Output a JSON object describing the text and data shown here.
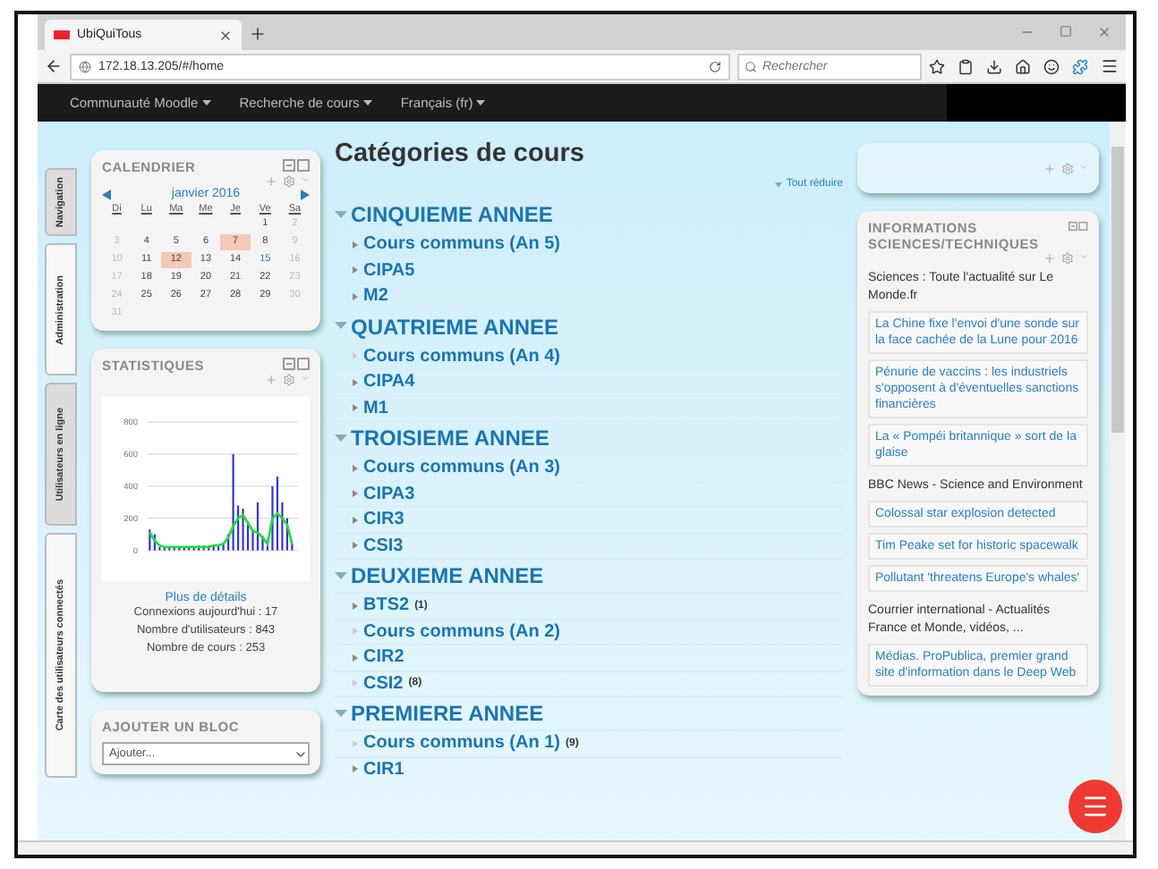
{
  "browser": {
    "tab_title": "UbiQuiTous",
    "url": "172.18.13.205/#/home",
    "search_placeholder": "Rechercher"
  },
  "navbar": {
    "items": [
      "Communauté Moodle",
      "Recherche de cours",
      "Français (fr)"
    ]
  },
  "side_tabs": [
    {
      "label": "Navigation",
      "selected": false
    },
    {
      "label": "Administration",
      "selected": true
    },
    {
      "label": "Utilisateurs en ligne",
      "selected": false
    },
    {
      "label": "Carte des utilisateurs connectés",
      "selected": true
    }
  ],
  "calendar": {
    "title": "CALENDRIER",
    "month": "janvier 2016",
    "weekdays": [
      "Di",
      "Lu",
      "Ma",
      "Me",
      "Je",
      "Ve",
      "Sa"
    ],
    "weeks": [
      [
        {
          "day": "1",
          "highlight": false,
          "today": false
        },
        {
          "day": "2",
          "highlight": false,
          "today": false
        }
      ],
      [
        {
          "day": "3",
          "highlight": false,
          "today": false
        },
        {
          "day": "4",
          "highlight": false,
          "today": false
        },
        {
          "day": "5",
          "highlight": false,
          "today": false
        },
        {
          "day": "6",
          "highlight": false,
          "today": false
        },
        {
          "day": "7",
          "highlight": true,
          "today": false
        },
        {
          "day": "8",
          "highlight": false,
          "today": false
        },
        {
          "day": "9",
          "highlight": false,
          "today": false
        }
      ],
      [
        {
          "day": "10",
          "highlight": false,
          "today": false
        },
        {
          "day": "11",
          "highlight": false,
          "today": false
        },
        {
          "day": "12",
          "highlight": true,
          "today": false
        },
        {
          "day": "13",
          "highlight": false,
          "today": false
        },
        {
          "day": "14",
          "highlight": false,
          "today": false
        },
        {
          "day": "15",
          "highlight": false,
          "today": true
        },
        {
          "day": "16",
          "highlight": false,
          "today": false
        }
      ],
      [
        {
          "day": "17",
          "highlight": false,
          "today": false
        },
        {
          "day": "18",
          "highlight": false,
          "today": false
        },
        {
          "day": "19",
          "highlight": false,
          "today": false
        },
        {
          "day": "20",
          "highlight": false,
          "today": false
        },
        {
          "day": "21",
          "highlight": false,
          "today": false
        },
        {
          "day": "22",
          "highlight": false,
          "today": false
        },
        {
          "day": "23",
          "highlight": false,
          "today": false
        }
      ],
      [
        {
          "day": "24",
          "highlight": false,
          "today": false
        },
        {
          "day": "25",
          "highlight": false,
          "today": false
        },
        {
          "day": "26",
          "highlight": false,
          "today": false
        },
        {
          "day": "27",
          "highlight": false,
          "today": false
        },
        {
          "day": "28",
          "highlight": false,
          "today": false
        },
        {
          "day": "29",
          "highlight": false,
          "today": false
        },
        {
          "day": "30",
          "highlight": false,
          "today": false
        }
      ],
      [
        {
          "day": "31",
          "highlight": false,
          "today": false
        }
      ]
    ]
  },
  "statistics": {
    "title": "STATISTIQUES",
    "chart_data": {
      "type": "bar",
      "ylim": [
        0,
        800
      ],
      "yticks": [
        0,
        200,
        400,
        600,
        800
      ],
      "grid": true,
      "series": [
        {
          "type": "bar",
          "color": "#3434d0",
          "values": [
            130,
            100,
            20,
            20,
            20,
            20,
            20,
            20,
            20,
            20,
            30,
            30,
            30,
            30,
            30,
            40,
            100,
            600,
            280,
            260,
            180,
            130,
            300,
            90,
            30,
            400,
            460,
            300,
            200,
            40
          ]
        },
        {
          "type": "line",
          "color": "#22dd33",
          "values": [
            110,
            60,
            30,
            20,
            20,
            20,
            20,
            20,
            20,
            20,
            20,
            20,
            20,
            30,
            30,
            40,
            80,
            150,
            200,
            220,
            170,
            120,
            110,
            80,
            40,
            200,
            230,
            200,
            160,
            40
          ]
        }
      ]
    },
    "details_link": "Plus de détails",
    "lines": [
      "Connexions aujourd'hui : 17",
      "Nombre d'utilisateurs : 843",
      "Nombre de cours : 253"
    ]
  },
  "add_block": {
    "title": "AJOUTER UN BLOC",
    "select_value": "Ajouter..."
  },
  "main": {
    "title": "Catégories de cours",
    "collapse_all": "Tout réduire",
    "categories": [
      {
        "name": "CINQUIEME ANNEE",
        "expanded": true,
        "children": [
          {
            "name": "Cours communs (An 5)",
            "expandable": true
          },
          {
            "name": "CIPA5",
            "expandable": true
          },
          {
            "name": "M2",
            "expandable": true
          }
        ]
      },
      {
        "name": "QUATRIEME ANNEE",
        "expanded": true,
        "children": [
          {
            "name": "Cours communs (An 4)",
            "expandable": false
          },
          {
            "name": "CIPA4",
            "expandable": true
          },
          {
            "name": "M1",
            "expandable": true
          }
        ]
      },
      {
        "name": "TROISIEME ANNEE",
        "expanded": true,
        "children": [
          {
            "name": "Cours communs (An 3)",
            "expandable": true
          },
          {
            "name": "CIPA3",
            "expandable": true
          },
          {
            "name": "CIR3",
            "expandable": true
          },
          {
            "name": "CSI3",
            "expandable": true
          }
        ]
      },
      {
        "name": "DEUXIEME ANNEE",
        "expanded": true,
        "children": [
          {
            "name": "BTS2",
            "count": "(1)",
            "expandable": true
          },
          {
            "name": "Cours communs (An 2)",
            "expandable": false
          },
          {
            "name": "CIR2",
            "expandable": true
          },
          {
            "name": "CSI2",
            "count": "(8)",
            "expandable": false
          }
        ]
      },
      {
        "name": "PREMIERE ANNEE",
        "expanded": true,
        "children": [
          {
            "name": "Cours communs (An 1)",
            "count": "(9)",
            "expandable": false
          },
          {
            "name": "CIR1",
            "expandable": true
          }
        ]
      }
    ]
  },
  "news_block": {
    "title": "INFORMATIONS SCIENCES/TECHNIQUES",
    "feeds": [
      {
        "source": "Sciences : Toute l'actualité sur Le Monde.fr",
        "links": [
          "La Chine fixe l'envoi d'une sonde sur la face cachée de la Lune pour 2016",
          "Pénurie de vaccins : les industriels s'opposent à d'éventuelles sanctions financières",
          "La « Pompéi britannique » sort de la glaise"
        ]
      },
      {
        "source": "BBC News - Science and Environment",
        "links": [
          "Colossal star explosion detected",
          "Tim Peake set for historic spacewalk",
          "Pollutant 'threatens Europe's whales'"
        ]
      },
      {
        "source": "Courrier international - Actualités France et Monde, vidéos, ...",
        "links": [
          "Médias. ProPublica, premier grand site d'information dans le Deep Web"
        ]
      }
    ]
  }
}
